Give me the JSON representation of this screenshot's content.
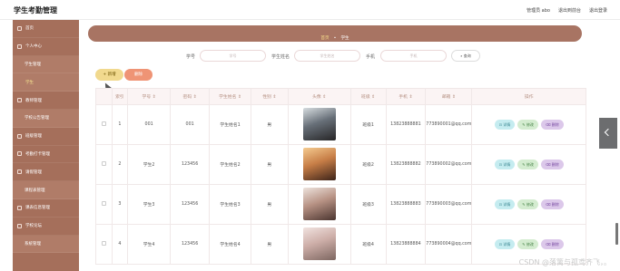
{
  "app": {
    "title": "学生考勤管理"
  },
  "topnav": {
    "user": "管理员 abo",
    "back_to_front": "退出到前台",
    "logout": "退出登录"
  },
  "sidebar": {
    "items": [
      {
        "label": "首页"
      },
      {
        "label": "个人中心"
      },
      {
        "label": "学生管理"
      },
      {
        "label": "学生"
      },
      {
        "label": "教师管理"
      },
      {
        "label": "学校公告管理"
      },
      {
        "label": "班级管理"
      },
      {
        "label": "考勤打卡管理"
      },
      {
        "label": "请假管理"
      },
      {
        "label": "课程表管理"
      },
      {
        "label": "课表信息管理"
      },
      {
        "label": "学校论坛"
      },
      {
        "label": "系统管理"
      }
    ]
  },
  "breadcrumb": {
    "home": "首页",
    "sep": "•",
    "current": "学生"
  },
  "search": {
    "no_label": "学号",
    "no_placeholder": "学号",
    "name_label": "学生姓名",
    "name_placeholder": "学生姓名",
    "phone_label": "手机",
    "phone_placeholder": "手机",
    "button": "查询"
  },
  "actions": {
    "add": "+ 新增",
    "delete": "删除"
  },
  "table": {
    "headers": [
      "",
      "索引",
      "学号 ⇕",
      "密码 ⇕",
      "学生姓名 ⇕",
      "性别 ⇕",
      "头像 ⇕",
      "班级 ⇕",
      "手机 ⇕",
      "邮箱 ⇕",
      "操作"
    ],
    "rows": [
      {
        "index": "1",
        "no": "001",
        "pwd": "001",
        "name": "学生姓名1",
        "gender": "男",
        "class": "班级1",
        "phone": "13823888881",
        "email": "773890001@qq.com"
      },
      {
        "index": "2",
        "no": "学生2",
        "pwd": "123456",
        "name": "学生姓名2",
        "gender": "男",
        "class": "班级2",
        "phone": "13823888882",
        "email": "773890002@qq.com"
      },
      {
        "index": "3",
        "no": "学生3",
        "pwd": "123456",
        "name": "学生姓名3",
        "gender": "男",
        "class": "班级3",
        "phone": "13823888883",
        "email": "773890003@qq.com"
      },
      {
        "index": "4",
        "no": "学生4",
        "pwd": "123456",
        "name": "学生姓名4",
        "gender": "男",
        "class": "班级4",
        "phone": "13823888884",
        "email": "773890004@qq.com"
      }
    ],
    "ops": {
      "detail": "详情",
      "edit": "修改",
      "delete": "删除"
    }
  },
  "watermark": "CSDN @落篱与孤鸢齐飞，。"
}
